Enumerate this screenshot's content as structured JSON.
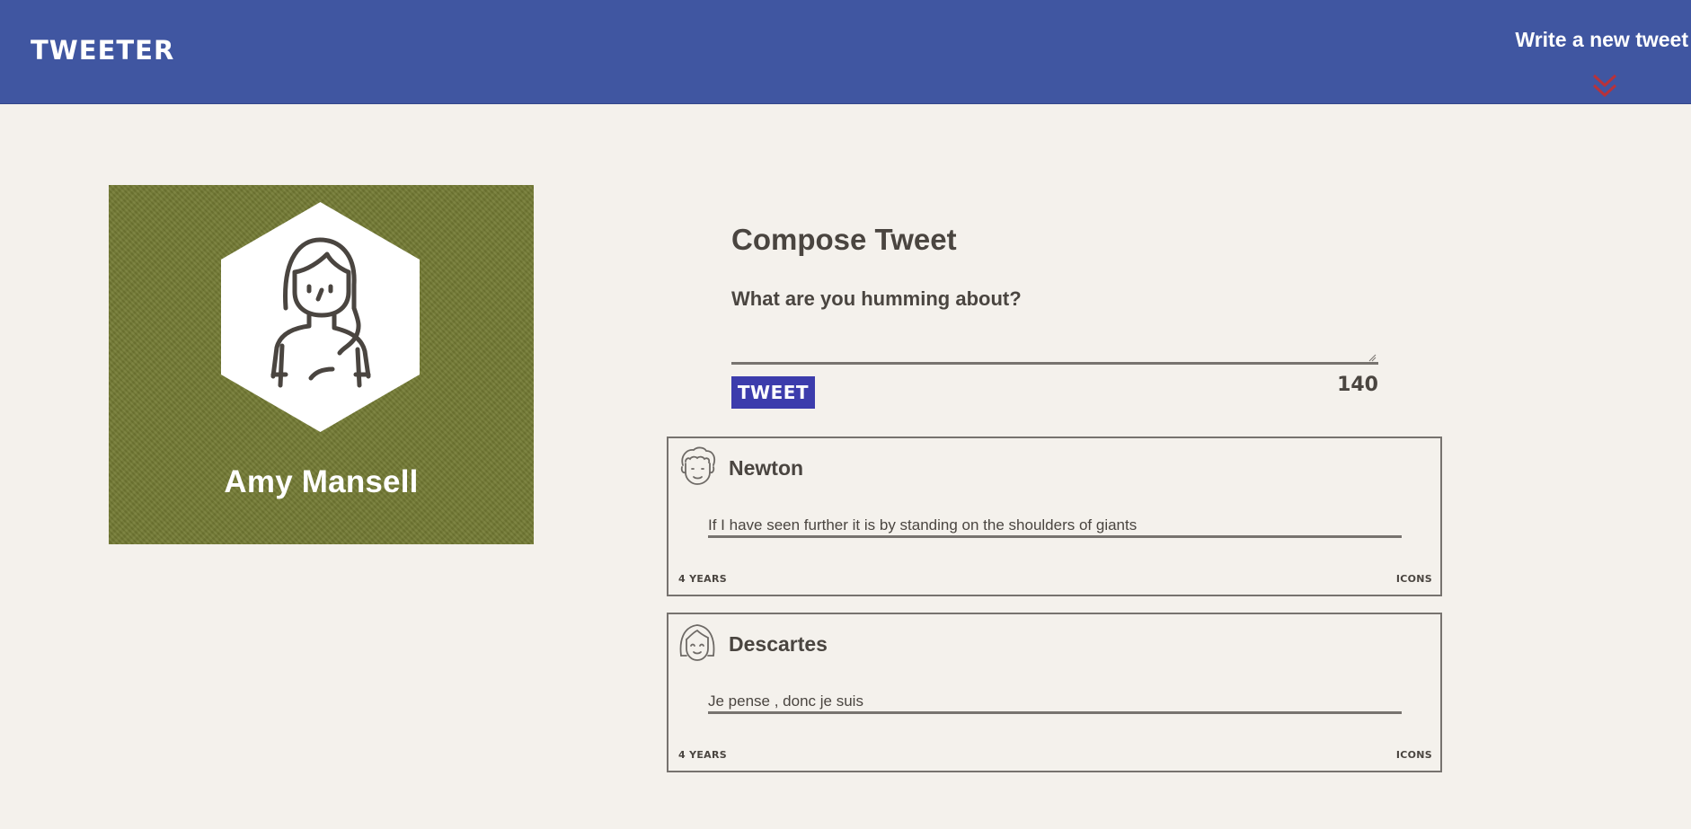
{
  "header": {
    "brand": "TWEETER",
    "write_link": "Write a new tweet",
    "background": "#4056a1",
    "toggle_icon": "double-chevron-down-icon",
    "toggle_icon_color": "#b8323a"
  },
  "profile": {
    "name": "Amy Mansell",
    "avatar_icon": "woman-avatar-icon",
    "background": "#737a33"
  },
  "compose": {
    "title": "Compose Tweet",
    "placeholder": "What are you humming about?",
    "value": "",
    "button_label": "TWEET",
    "button_color": "#3c3cac",
    "counter": "140"
  },
  "tweets": [
    {
      "author": "Newton",
      "avatar_icon": "curly-hair-man-avatar-icon",
      "text": "If I have seen further it is by standing on the shoulders of giants",
      "age": "4 YEARS",
      "actions": "ICONS"
    },
    {
      "author": "Descartes",
      "avatar_icon": "bob-hair-avatar-icon",
      "text": "Je pense , donc je suis",
      "age": "4 YEARS",
      "actions": "ICONS"
    }
  ]
}
